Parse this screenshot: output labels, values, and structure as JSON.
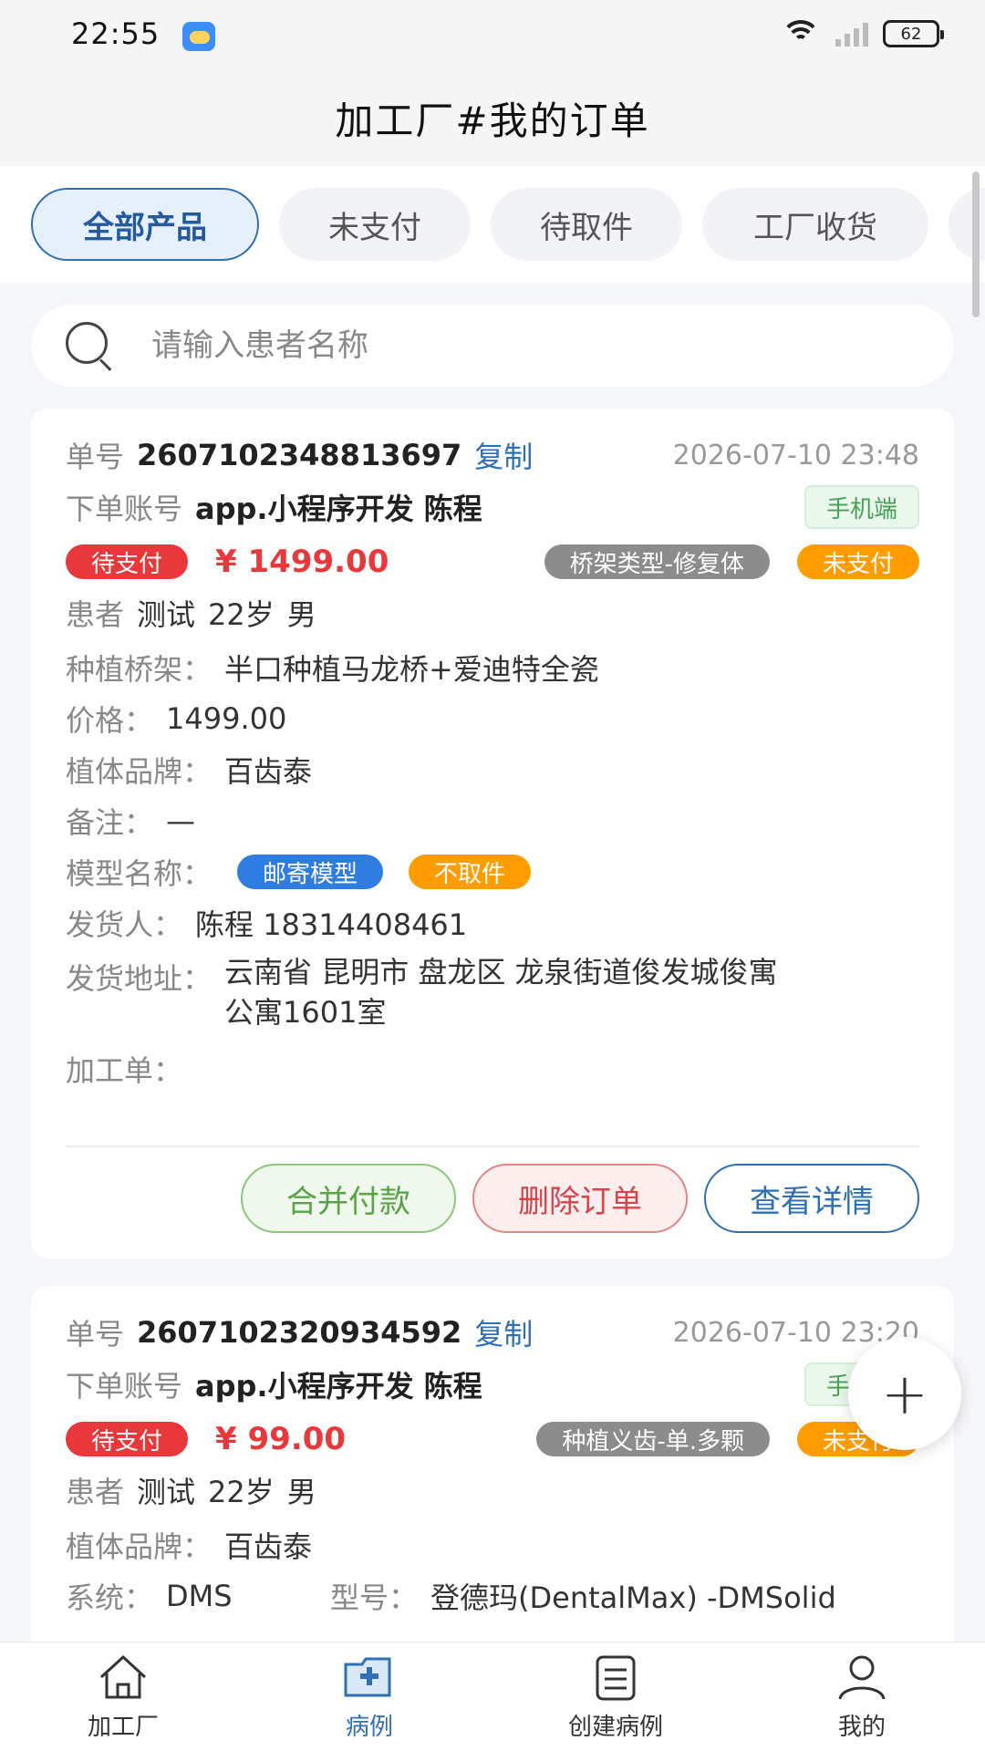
{
  "status_bar": {
    "time": "22:55",
    "battery": "62"
  },
  "header": {
    "title": "加工厂#我的订单"
  },
  "tabs": [
    {
      "label": "全部产品",
      "active": true
    },
    {
      "label": "未支付",
      "active": false
    },
    {
      "label": "待取件",
      "active": false
    },
    {
      "label": "工厂收货",
      "active": false
    }
  ],
  "search": {
    "placeholder": "请输入患者名称"
  },
  "orders": [
    {
      "order_label": "单号",
      "order_no": "2607102348813697",
      "copy_label": "复制",
      "datetime": "2026-07-10 23:48",
      "account_label": "下单账号",
      "account": "app.小程序开发 陈程",
      "device_tag": "手机端",
      "pay_status": "待支付",
      "price": "¥ 1499.00",
      "type_tag": "桥架类型-修复体",
      "unpaid_tag": "未支付",
      "patient_label": "患者",
      "patient_name": "测试",
      "patient_age": "22岁",
      "patient_gender": "男",
      "bridge_label": "种植桥架：",
      "bridge_value": "半口种植马龙桥+爱迪特全瓷",
      "price_label": "价格：",
      "price_value": "1499.00",
      "brand_label": "植体品牌：",
      "brand_value": "百齿泰",
      "note_label": "备注：",
      "note_value": "—",
      "model_label": "模型名称：",
      "model_tag1": "邮寄模型",
      "model_tag2": "不取件",
      "sender_label": "发货人：",
      "sender_value": "陈程 18314408461",
      "address_label": "发货地址：",
      "address_line1": "云南省 昆明市 盘龙区 龙泉街道俊发城俊寓",
      "address_line2": "公寓1601室",
      "process_label": "加工单：",
      "actions": {
        "merge": "合并付款",
        "delete": "删除订单",
        "detail": "查看详情"
      }
    },
    {
      "order_label": "单号",
      "order_no": "2607102320934592",
      "copy_label": "复制",
      "datetime": "2026-07-10 23:20",
      "account_label": "下单账号",
      "account": "app.小程序开发 陈程",
      "device_tag": "手机端",
      "pay_status": "待支付",
      "price": "¥ 99.00",
      "type_tag": "种植义齿-单.多颗",
      "unpaid_tag": "未支付",
      "patient_label": "患者",
      "patient_name": "测试",
      "patient_age": "22岁",
      "patient_gender": "男",
      "brand_label": "植体品牌：",
      "brand_value": "百齿泰",
      "system_label": "系统：",
      "system_value": "DMS",
      "model_no_label": "型号：",
      "model_no_value": "登德玛(DentalMax) -DMSolid"
    }
  ],
  "bottom_nav": [
    {
      "label": "加工厂",
      "active": false
    },
    {
      "label": "病例",
      "active": true
    },
    {
      "label": "创建病例",
      "active": false
    },
    {
      "label": "我的",
      "active": false
    }
  ]
}
